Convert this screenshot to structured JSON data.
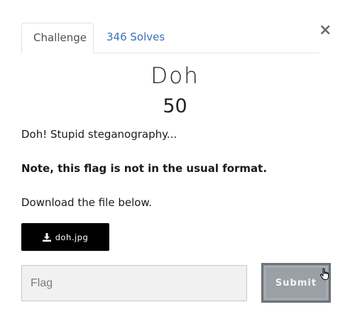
{
  "tabs": [
    {
      "label": "Challenge"
    },
    {
      "label": "346 Solves"
    }
  ],
  "close_label": "×",
  "challenge": {
    "name": "Doh",
    "value": "50",
    "description": [
      "Doh! Stupid steganography...",
      "Note, this flag is not in the usual format.",
      "Download the file below."
    ]
  },
  "file": {
    "label": "doh.jpg",
    "icon": "download-icon"
  },
  "flag": {
    "placeholder": "Flag",
    "value": ""
  },
  "submit_label": "Submit",
  "colors": {
    "link": "#3b6fb6",
    "submit_bg": "#9aa0a6",
    "download_bg": "#000000"
  }
}
